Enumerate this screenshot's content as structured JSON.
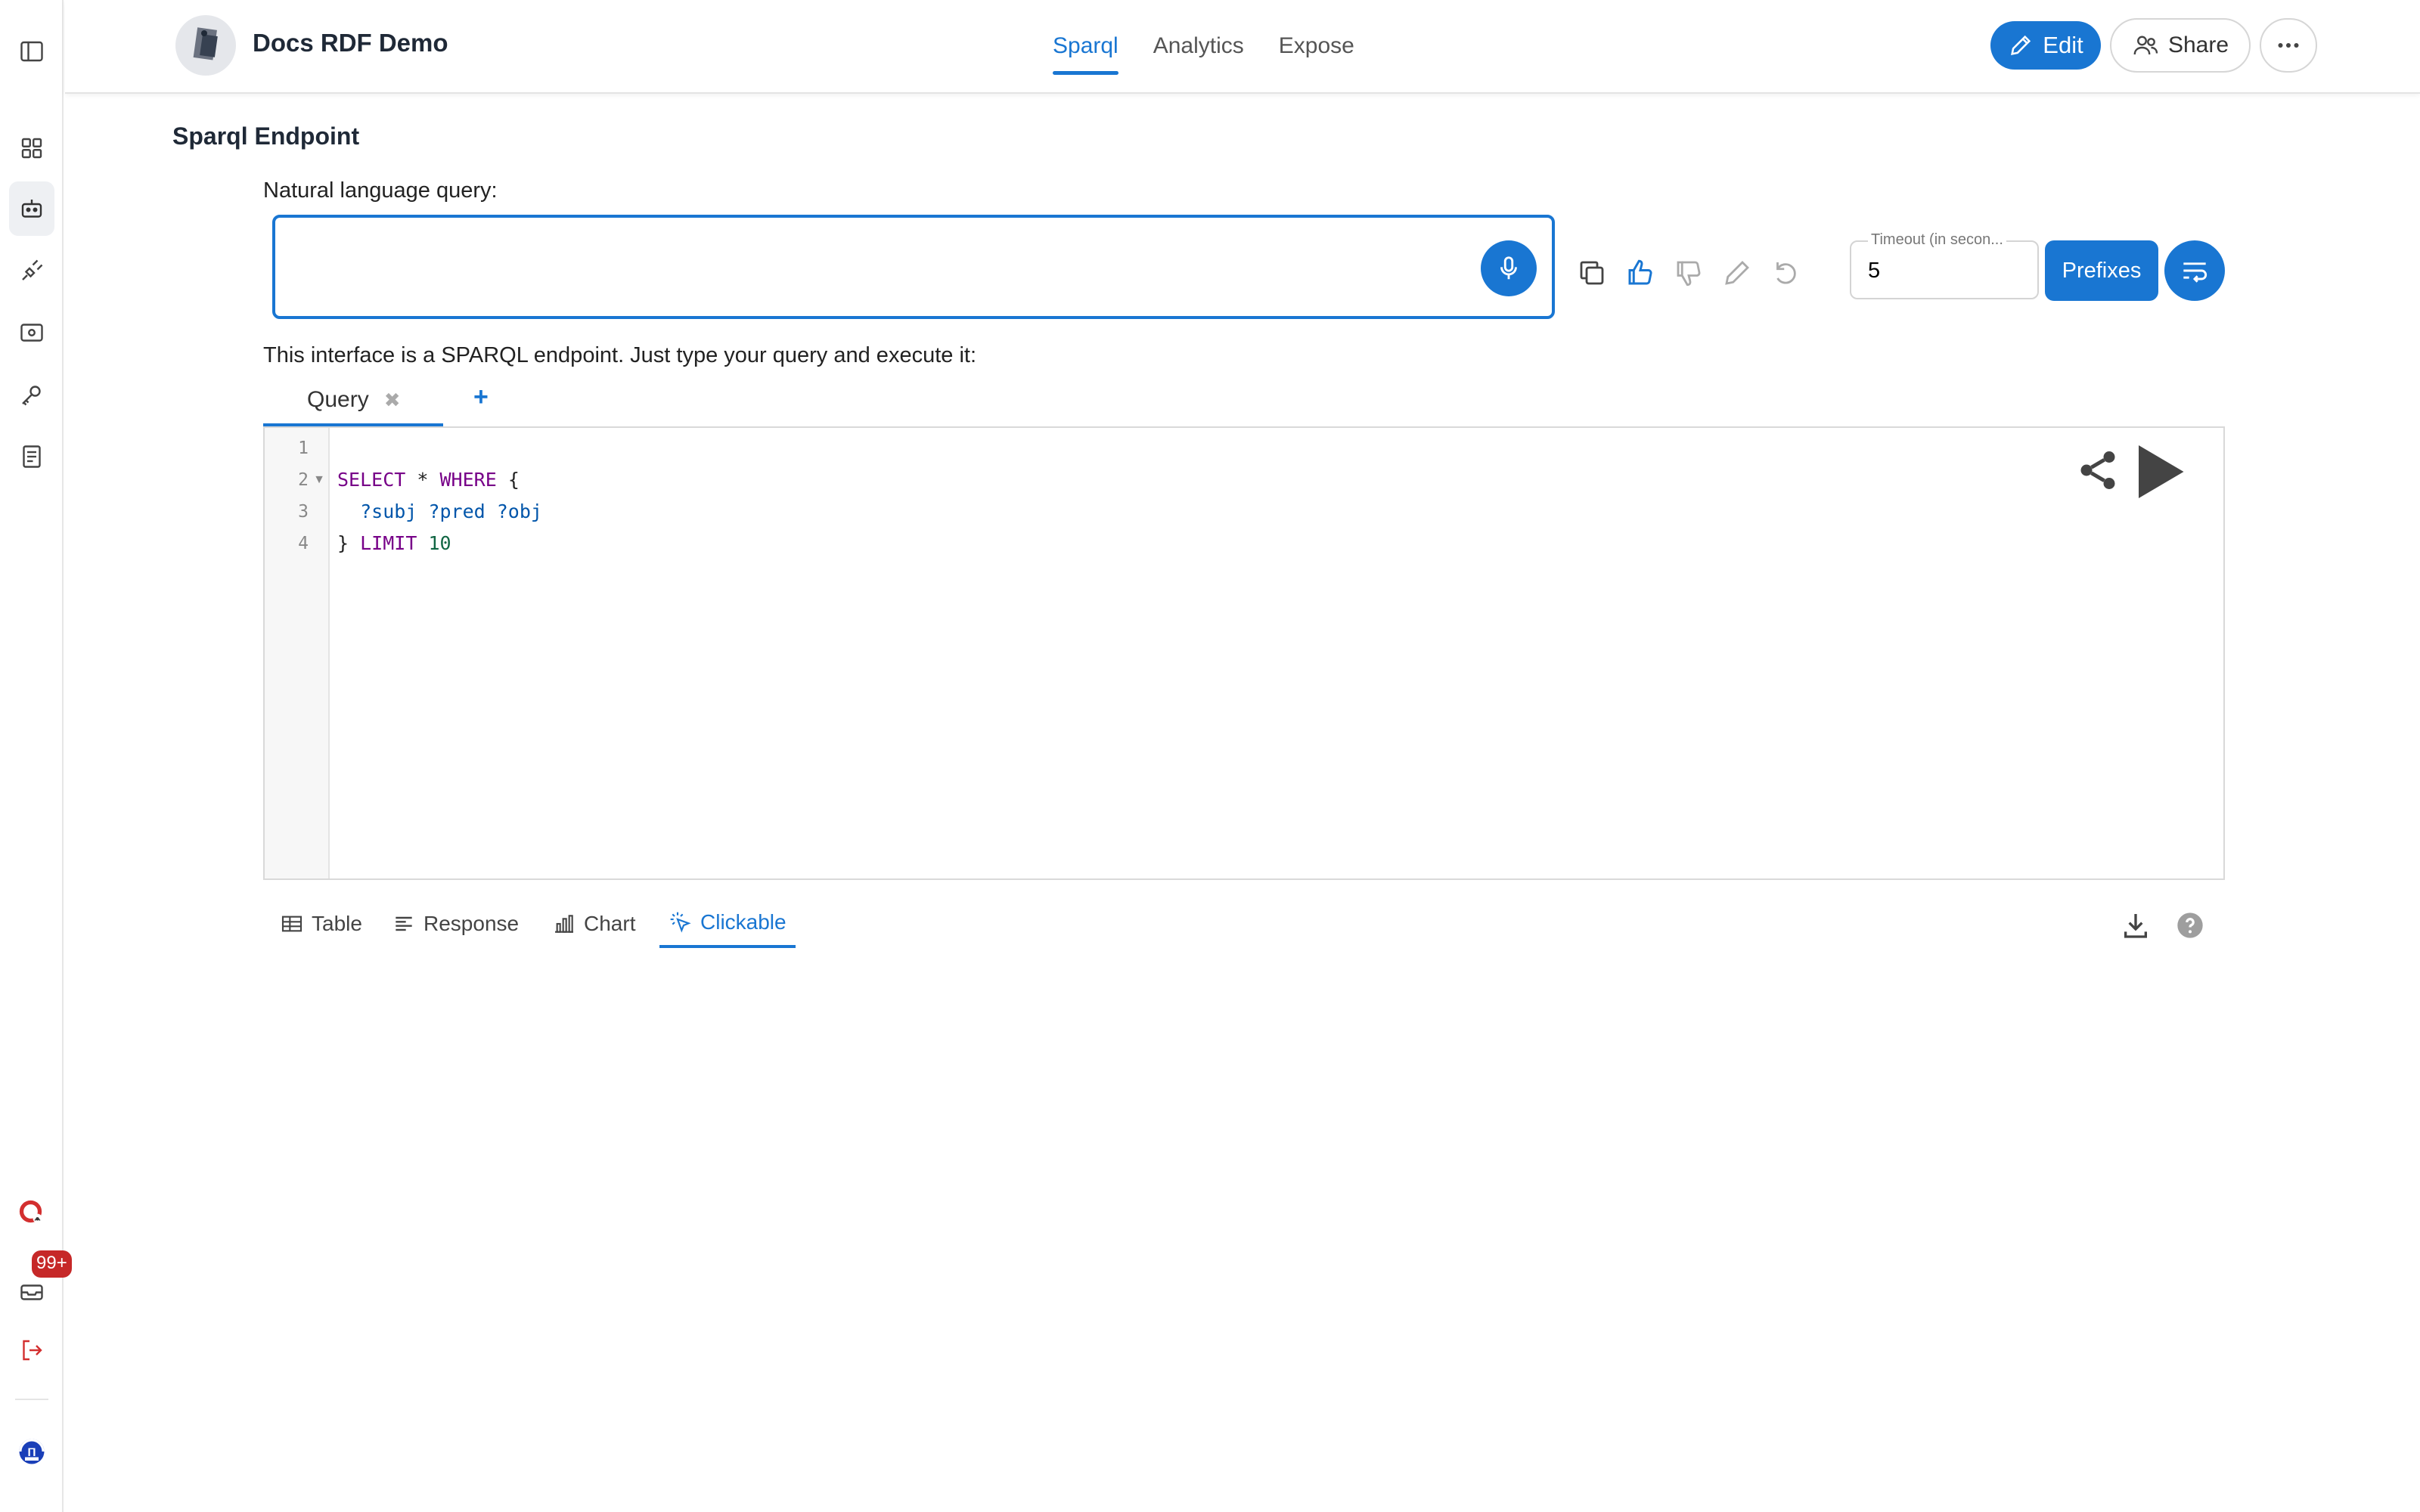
{
  "app": {
    "title": "Docs RDF Demo"
  },
  "nav": {
    "tabs": [
      {
        "label": "Sparql"
      },
      {
        "label": "Analytics"
      },
      {
        "label": "Expose"
      }
    ],
    "active": "Sparql"
  },
  "header": {
    "edit_label": "Edit",
    "share_label": "Share"
  },
  "rail": {
    "notification_badge": "99+"
  },
  "page": {
    "section_title": "Sparql Endpoint",
    "nl_label": "Natural language query:",
    "nl_value": "",
    "timeout_label": "Timeout (in secon...",
    "timeout_value": "5",
    "prefixes_label": "Prefixes",
    "intro": "This interface is a SPARQL endpoint. Just type your query and execute it:"
  },
  "query_tabs": [
    {
      "label": "Query",
      "close": "✖"
    }
  ],
  "query_tab_add": "+",
  "editor": {
    "line_numbers": [
      "1",
      "2",
      "3",
      "4"
    ],
    "lines": [
      "",
      "SELECT * WHERE {",
      "  ?subj ?pred ?obj",
      "} LIMIT 10"
    ]
  },
  "result_tabs": [
    {
      "label": "Table"
    },
    {
      "label": "Response"
    },
    {
      "label": "Chart"
    },
    {
      "label": "Clickable"
    }
  ],
  "result_active": "Clickable",
  "colors": {
    "accent": "#1976d2",
    "keyword": "#770088",
    "variable": "#0055aa",
    "number": "#116644"
  }
}
